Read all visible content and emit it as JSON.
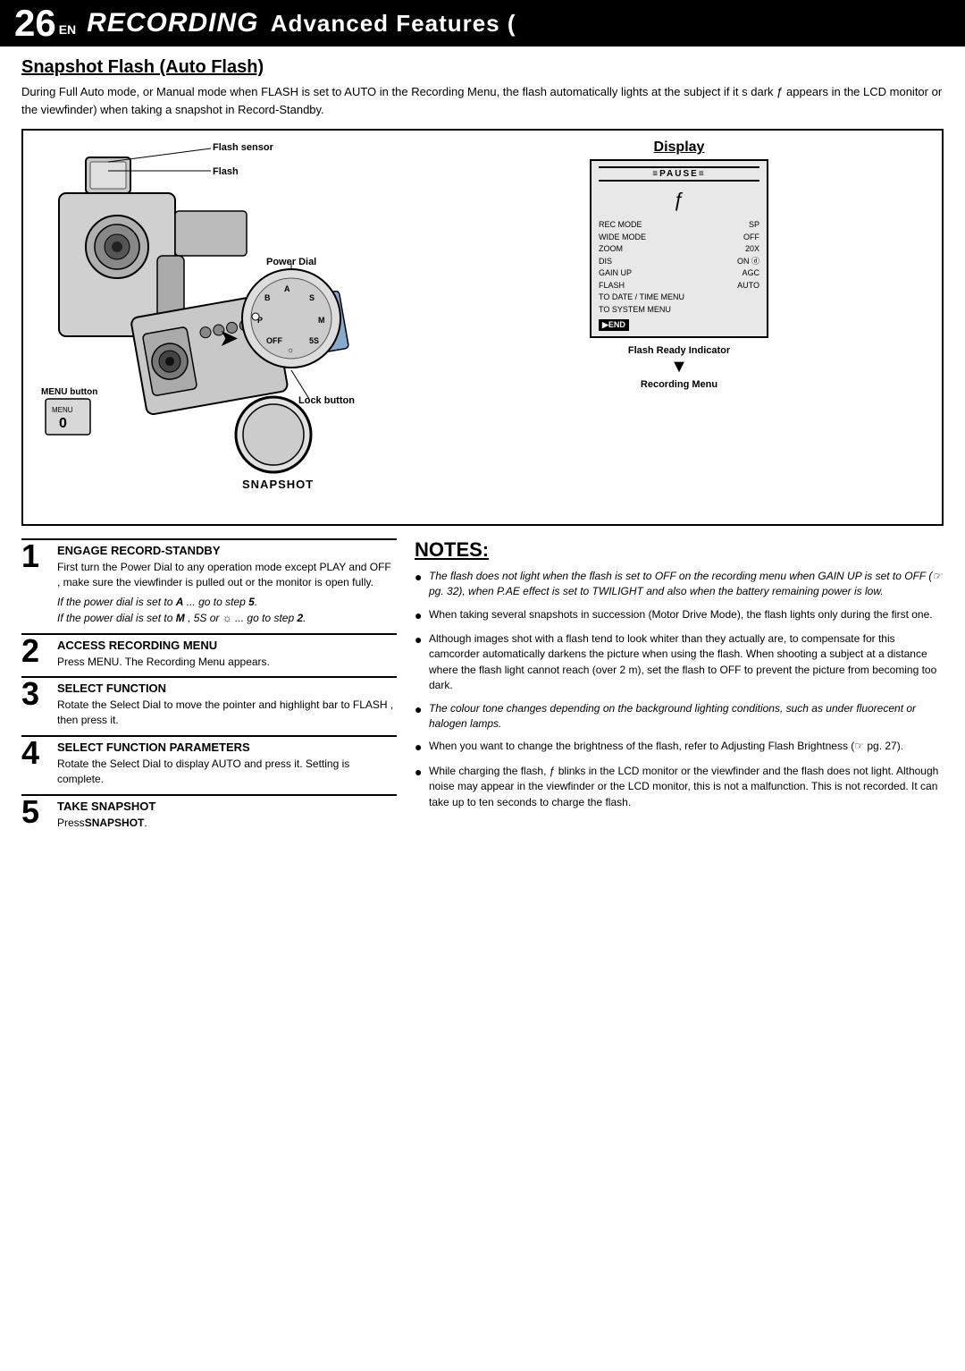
{
  "header": {
    "page_number": "26",
    "en_label": "EN",
    "title_recording": "RECORDING",
    "title_rest": "Advanced Features ("
  },
  "section": {
    "title": "Snapshot Flash (Auto Flash)",
    "intro": "During Full Auto mode, or Manual mode when  FLASH  is set to  AUTO  in the Recording Menu, the flash automatically lights at the subject if it s dark ƒ appears in the LCD monitor or the viewfinder) when taking a snapshot in Record-Standby."
  },
  "diagram": {
    "display_label": "Display",
    "flash_sensor_label": "Flash sensor",
    "flash_label": "Flash",
    "power_dial_label": "Power Dial",
    "lock_button_label": "Lock button",
    "menu_button_label": "MENU button",
    "snapshot_label": "SNAPSHOT",
    "flash_ready_label": "Flash Ready Indicator",
    "recording_menu_label": "Recording Menu",
    "lcd": {
      "pause": "≡PAUSE≡",
      "flash_symbol": "ƒ",
      "menu_rows": [
        {
          "label": "REC MODE",
          "value": "SP"
        },
        {
          "label": "WIDE MODE",
          "value": "OFF"
        },
        {
          "label": "ZOOM",
          "value": "20X"
        },
        {
          "label": "DIS",
          "value": "ON ⓓ"
        },
        {
          "label": "GAIN UP",
          "value": "AGC"
        },
        {
          "label": "FLASH",
          "value": "AUTO"
        },
        {
          "label": "TO DATE / TIME MENU",
          "value": ""
        },
        {
          "label": "TO SYSTEM MENU",
          "value": ""
        }
      ],
      "end_label": "▶END"
    }
  },
  "steps": [
    {
      "number": "1",
      "heading": "ENGAGE RECORD-STANDBY",
      "text": "First turn the Power Dial to any operation mode except  PLAY  and  OFF , make sure the viewfinder is pulled out or the monitor is open fully.",
      "italic_lines": [
        "If the power dial is set to A  ... go to step 5.",
        "If the power dial is set to M , 5S  or  ☼ ... go to step 2."
      ]
    },
    {
      "number": "2",
      "heading": "ACCESS RECORDING MENU",
      "text": "Press MENU. The Recording Menu appears."
    },
    {
      "number": "3",
      "heading": "SELECT FUNCTION",
      "text": "Rotate the Select Dial to move the pointer and highlight bar to  FLASH , then press it."
    },
    {
      "number": "4",
      "heading": "SELECT FUNCTION PARAMETERS",
      "text": "Rotate the Select Dial to display  AUTO  and press it. Setting is complete."
    },
    {
      "number": "5",
      "heading": "TAKE SNAPSHOT",
      "text": "Press SNAPSHOT."
    }
  ],
  "notes": {
    "heading": "NOTES:",
    "items": [
      {
        "italic": true,
        "text": "The flash does not light when the flash is set to  OFF  on the recording menu when GAIN UP is set to  OFF  (☞ pg. 32), when P.AE effect is set to  TWILIGHT  and also when the battery remaining power is low."
      },
      {
        "italic": false,
        "text": "When taking several snapshots in succession (Motor Drive Mode), the flash lights only during the first one."
      },
      {
        "italic": false,
        "text": "Although images shot with a flash tend to look whiter than they actually are, to compensate for this camcorder automatically darkens the picture when using the flash. When shooting a subject at a distance where the flash light cannot reach (over 2 m), set the flash to  OFF  to prevent the picture from becoming too dark."
      },
      {
        "italic": true,
        "text": "The colour tone changes depending on the background lighting conditions, such as under fluorecent or halogen lamps."
      },
      {
        "italic": false,
        "text": "When you want to change the brightness of the flash, refer to  Adjusting Flash Brightness (☞ pg. 27)."
      },
      {
        "italic": false,
        "text": "While charging the flash, ƒ blinks in the LCD monitor or the viewfinder and the flash does not light. Although noise may appear in the viewfinder or the LCD monitor, this is not a malfunction. This is not recorded. It can take up to ten seconds to charge the flash."
      }
    ]
  }
}
